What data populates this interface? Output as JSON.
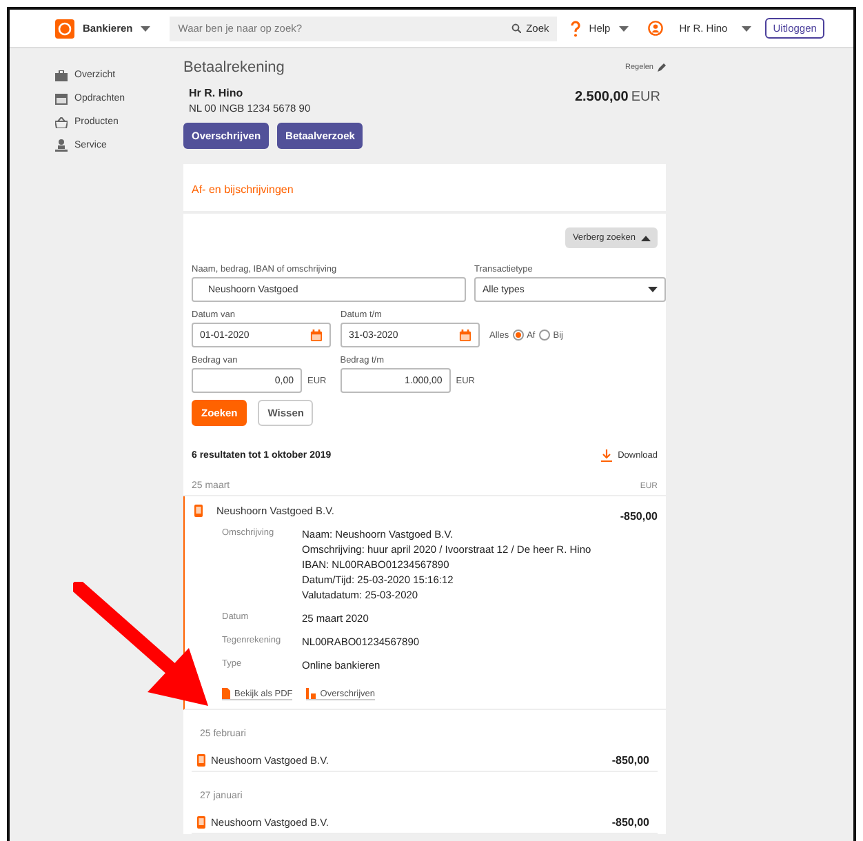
{
  "header": {
    "brand": "Bankieren",
    "search_placeholder": "Waar ben je naar op zoek?",
    "search_button": "Zoek",
    "help": "Help",
    "user": "Hr R. Hino",
    "logout": "Uitloggen"
  },
  "sidebar": {
    "items": [
      {
        "label": "Overzicht",
        "kind": "briefcase"
      },
      {
        "label": "Opdrachten",
        "kind": "calendar"
      },
      {
        "label": "Producten",
        "kind": "basket"
      },
      {
        "label": "Service",
        "kind": "person"
      }
    ]
  },
  "account": {
    "title": "Betaalrekening",
    "settings_link": "Regelen",
    "holder": "Hr R. Hino",
    "iban": "NL 00 INGB 1234 5678 90",
    "balance": "2.500,00",
    "currency": "EUR",
    "buttons": [
      "Overschrijven",
      "Betaalverzoek"
    ]
  },
  "transactions": {
    "title": "Af- en bijschrijvingen",
    "toggle": "Verberg zoeken",
    "search": {
      "query": {
        "label": "Naam, bedrag, IBAN of omschrijving",
        "value": "Neushoorn Vastgoed"
      },
      "type": {
        "label": "Transactietype",
        "value": "Alle types"
      },
      "date_from": {
        "label": "Datum van",
        "value": "01-01-2020"
      },
      "date_to": {
        "label": "Datum t/m",
        "value": "31-03-2020"
      },
      "direction": {
        "label": "Alles",
        "options": [
          {
            "label": "Af",
            "selected": true
          },
          {
            "label": "Bij",
            "selected": false
          }
        ]
      },
      "amount_from": {
        "label": "Bedrag van",
        "value": "0,00",
        "currency": "EUR"
      },
      "amount_to": {
        "label": "Bedrag t/m",
        "value": "1.000,00",
        "currency": "EUR"
      },
      "buttons": [
        "Zoeken",
        "Wissen"
      ]
    },
    "summary": "6 resultaten tot 1 oktober 2019",
    "download": "Download",
    "groups": [
      {
        "date": "25 maart",
        "currency": "EUR",
        "entries": [
          {
            "name": "Neushoorn Vastgoed B.V.",
            "amount": "-850,00",
            "expanded": true,
            "details": [
              {
                "label": "Omschrijving",
                "lines": [
                  "Naam: Neushoorn Vastgoed B.V.",
                  "Omschrijving: huur april 2020 / Ivoorstraat 12 / De heer R. Hino",
                  "IBAN: NL00RABO01234567890",
                  "Datum/Tijd: 25-03-2020 15:16:12",
                  "Valutadatum: 25-03-2020"
                ]
              },
              {
                "label": "Datum",
                "lines": [
                  "25 maart 2020"
                ]
              },
              {
                "label": "Tegenrekening",
                "lines": [
                  "NL00RABO01234567890"
                ]
              },
              {
                "label": "Type",
                "lines": [
                  "Online bankieren"
                ]
              }
            ],
            "actions": [
              {
                "label": "Bekijk als PDF",
                "kind": "pdf"
              },
              {
                "label": "Overschrijven",
                "kind": "transfer"
              }
            ]
          }
        ]
      },
      {
        "date": "25 februari",
        "entries": [
          {
            "name": "Neushoorn Vastgoed B.V.",
            "amount": "-850,00",
            "expanded": false
          }
        ]
      },
      {
        "date": "27 januari",
        "entries": [
          {
            "name": "Neushoorn Vastgoed B.V.",
            "amount": "-850,00",
            "expanded": false
          }
        ]
      }
    ]
  }
}
